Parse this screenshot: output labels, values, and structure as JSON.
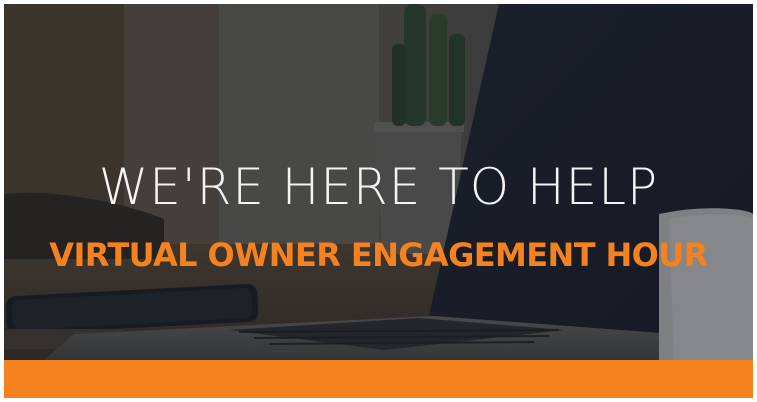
{
  "banner": {
    "headline": "WE'RE HERE TO HELP",
    "subheadline": "VIRTUAL OWNER ENGAGEMENT HOUR"
  },
  "colors": {
    "accent_orange": "#f5821f",
    "headline_white": "#f4f4f4",
    "overlay_dark": "#1b1f26"
  },
  "image": {
    "description_icon": "laptop-desk-photo"
  }
}
